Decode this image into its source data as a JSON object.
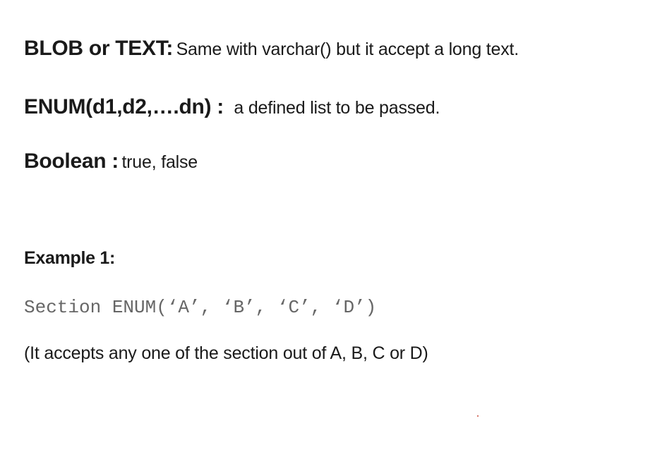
{
  "definitions": [
    {
      "term": "BLOB or TEXT:",
      "description": "Same with varchar() but it accept a long text."
    },
    {
      "term": "ENUM(d1,d2,….dn) :",
      "description": "a defined list to be passed."
    },
    {
      "term": "Boolean :",
      "description": "true, false"
    }
  ],
  "example": {
    "heading": "Example 1:",
    "code": "Section ENUM(‘A’, ‘B’, ‘C’, ‘D’)",
    "note": "(It accepts any one of the section out of A, B, C or D)"
  },
  "colors": {
    "text": "#1a1a1a",
    "code": "#666666",
    "background": "#ffffff"
  }
}
